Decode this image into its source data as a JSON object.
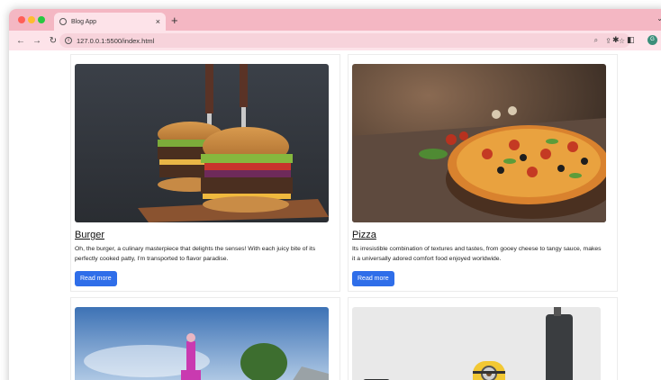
{
  "browser": {
    "tab_title": "Blog App",
    "tab_close": "×",
    "new_tab": "+",
    "tab_menu": "⌄",
    "url": "127.0.0.1:5500/index.html",
    "avatar_letter": "G"
  },
  "posts": [
    {
      "title": "Burger",
      "text": "Oh, the burger, a culinary masterpiece that delights the senses! With each juicy bite of its perfectly cooked patty, I'm transported to flavor paradise.",
      "button": "Read more"
    },
    {
      "title": "Pizza",
      "text": "Its irresistible combination of textures and tastes, from gooey cheese to tangy sauce, makes it a universally adored comfort food enjoyed worldwide.",
      "button": "Read more"
    }
  ],
  "colors": {
    "tab_strip": "#f4b7c3",
    "toolbar": "#fde3e9",
    "button": "#2f6ee9"
  }
}
